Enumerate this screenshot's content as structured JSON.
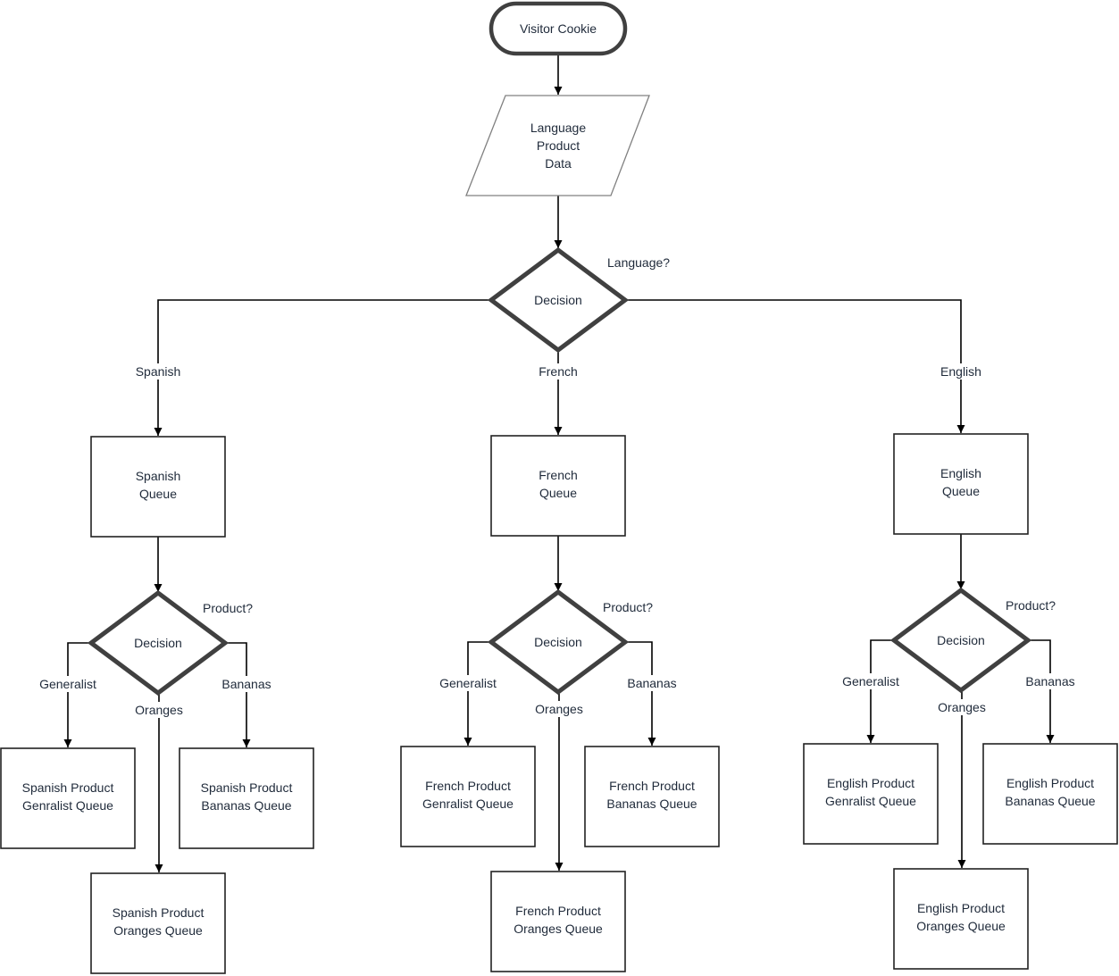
{
  "diagram": {
    "type": "flowchart",
    "start": {
      "label": "Visitor Cookie"
    },
    "input": {
      "lines": [
        "Language",
        "Product",
        "Data"
      ]
    },
    "language_decision": {
      "label": "Decision",
      "question": "Language?"
    },
    "languages": [
      {
        "id": "spanish",
        "edge_label": "Spanish",
        "queue_lines": [
          "Spanish",
          "Queue"
        ],
        "product_decision": {
          "label": "Decision",
          "question": "Product?"
        },
        "branches": {
          "generalist": {
            "edge_label": "Generalist",
            "lines": [
              "Spanish Product",
              "Genralist Queue"
            ]
          },
          "oranges": {
            "edge_label": "Oranges",
            "lines": [
              "Spanish Product",
              "Oranges Queue"
            ]
          },
          "bananas": {
            "edge_label": "Bananas",
            "lines": [
              "Spanish Product",
              "Bananas Queue"
            ]
          }
        }
      },
      {
        "id": "french",
        "edge_label": "French",
        "queue_lines": [
          "French",
          "Queue"
        ],
        "product_decision": {
          "label": "Decision",
          "question": "Product?"
        },
        "branches": {
          "generalist": {
            "edge_label": "Generalist",
            "lines": [
              "French Product",
              "Genralist Queue"
            ]
          },
          "oranges": {
            "edge_label": "Oranges",
            "lines": [
              "French Product",
              "Oranges Queue"
            ]
          },
          "bananas": {
            "edge_label": "Bananas",
            "lines": [
              "French Product",
              "Bananas Queue"
            ]
          }
        }
      },
      {
        "id": "english",
        "edge_label": "English",
        "queue_lines": [
          "English",
          "Queue"
        ],
        "product_decision": {
          "label": "Decision",
          "question": "Product?"
        },
        "branches": {
          "generalist": {
            "edge_label": "Generalist",
            "lines": [
              "English Product",
              "Genralist Queue"
            ]
          },
          "oranges": {
            "edge_label": "Oranges",
            "lines": [
              "English Product",
              "Oranges Queue"
            ]
          },
          "bananas": {
            "edge_label": "Bananas",
            "lines": [
              "English Product",
              "Bananas Queue"
            ]
          }
        }
      }
    ]
  }
}
